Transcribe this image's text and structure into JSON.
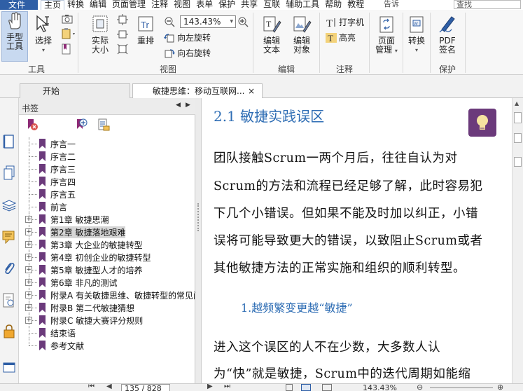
{
  "menubar": {
    "file": "文件",
    "items": [
      "主页",
      "转换",
      "编辑",
      "页面管理",
      "注释",
      "视图",
      "表单",
      "保护",
      "共享",
      "互联",
      "辅助工具",
      "帮助",
      "教程"
    ],
    "active_index": 0,
    "right_text": "告诉",
    "search_placeholder": "查找"
  },
  "ribbon": {
    "hand_tool": "手型\n工具",
    "select": "选择",
    "tools_group": "工具",
    "actual_size": "实际\n大小",
    "reflow": "重排",
    "zoom_value": "143.43%",
    "rotate_left": "向左旋转",
    "rotate_right": "向右旋转",
    "view_group": "视图",
    "edit_text": "编辑\n文本",
    "edit_object": "编辑\n对象",
    "edit_group": "编辑",
    "typewriter": "打字机",
    "highlight": "高亮",
    "comment_group": "注释",
    "page_manage": "页面\n管理",
    "convert": "转换",
    "pdf_sign": "PDF\n签名",
    "protect_group": "保护"
  },
  "tabs": [
    {
      "label": "开始"
    },
    {
      "label": "敏捷思维：移动互联网...",
      "close": "×"
    }
  ],
  "bookmarks": {
    "title": "书签",
    "items": [
      {
        "label": "序言一",
        "expandable": false
      },
      {
        "label": "序言二",
        "expandable": false
      },
      {
        "label": "序言三",
        "expandable": false
      },
      {
        "label": "序言四",
        "expandable": false
      },
      {
        "label": "序言五",
        "expandable": false
      },
      {
        "label": "前言",
        "expandable": false
      },
      {
        "label": "第1章  敏捷思潮",
        "expandable": true
      },
      {
        "label": "第2章  敏捷落地艰难",
        "expandable": true,
        "selected": true
      },
      {
        "label": "第3章  大企业的敏捷转型",
        "expandable": true
      },
      {
        "label": "第4章  初创企业的敏捷转型",
        "expandable": true
      },
      {
        "label": "第5章  敏捷型人才的培养",
        "expandable": true
      },
      {
        "label": "第6章  非凡的测试",
        "expandable": true
      },
      {
        "label": "附录A  有关敏捷思维、敏捷转型的常见问",
        "expandable": true
      },
      {
        "label": "附录B  第二代敏捷猜想",
        "expandable": true
      },
      {
        "label": "附录C  敏捷大赛评分规则",
        "expandable": true
      },
      {
        "label": "结束语",
        "expandable": false
      },
      {
        "label": "参考文献",
        "expandable": false
      }
    ]
  },
  "document": {
    "heading": "2.1    敏捷实践误区",
    "lines": [
      "    团队接触Scrum一两个月后，往往自认为对",
      "Scrum的方法和流程已经足够了解，此时容易犯",
      "下几个小错误。但如果不能及时加以纠正，小错",
      "误将可能导致更大的错误，以致阻止Scrum或者",
      "其他敏捷方法的正常实施和组织的顺利转型。"
    ],
    "subheading": "1.越频繁变更越“敏捷”",
    "lines2": [
      "    进入这个误区的人不在少数，大多数人认",
      "为“快”就是敏捷，Scrum中的迭代周期如能缩"
    ]
  },
  "status": {
    "page": "135 / 828",
    "zoom": "143.43%"
  },
  "colors": {
    "accent": "#2f5fa6",
    "heading_blue": "#2e6db4",
    "bookmark_purple": "#6b3a7b"
  }
}
